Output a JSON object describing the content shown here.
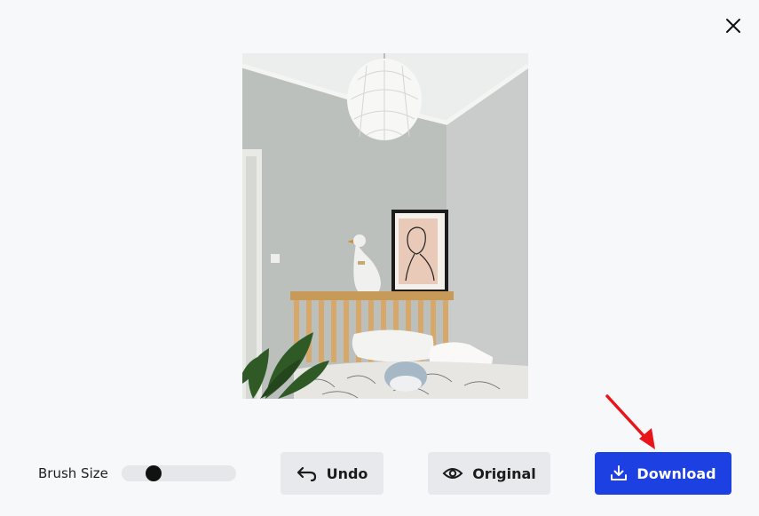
{
  "close": {
    "icon": "close-icon"
  },
  "preview": {
    "alt": "Bedroom photo preview"
  },
  "toolbar": {
    "brush_label": "Brush Size",
    "brush_value": 0.24,
    "undo_label": "Undo",
    "original_label": "Original",
    "download_label": "Download"
  },
  "colors": {
    "accent": "#1d40e2",
    "button_bg": "#e8e9ec",
    "annotation_arrow": "#e8161b",
    "background": "#f7f8fa"
  },
  "icons": [
    "close-icon",
    "undo-icon",
    "eye-icon",
    "download-icon",
    "red-arrow-icon"
  ]
}
